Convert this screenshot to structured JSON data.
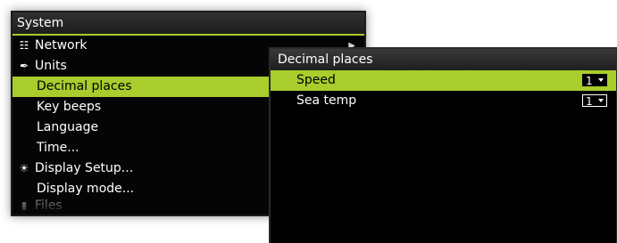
{
  "system_menu": {
    "title": "System",
    "items": [
      {
        "label": "Network",
        "icon": "network-icon",
        "glyph": "☷"
      },
      {
        "label": "Units",
        "icon": "pencil-icon",
        "glyph": "✒"
      },
      {
        "label": "Decimal places"
      },
      {
        "label": "Key beeps"
      },
      {
        "label": "Language"
      },
      {
        "label": "Time..."
      },
      {
        "label": "Display Setup...",
        "icon": "sun-icon",
        "glyph": "☀"
      },
      {
        "label": "Display mode..."
      },
      {
        "label": "Files"
      }
    ],
    "selected_item": "Decimal places"
  },
  "decimal_dialog": {
    "title": "Decimal places",
    "rows": [
      {
        "label": "Speed",
        "value": "1"
      },
      {
        "label": "Sea temp",
        "value": "1"
      }
    ],
    "selected_row": "Speed"
  },
  "colors": {
    "accent": "#a8cd2c",
    "background": "#000000",
    "text": "#ffffff"
  }
}
